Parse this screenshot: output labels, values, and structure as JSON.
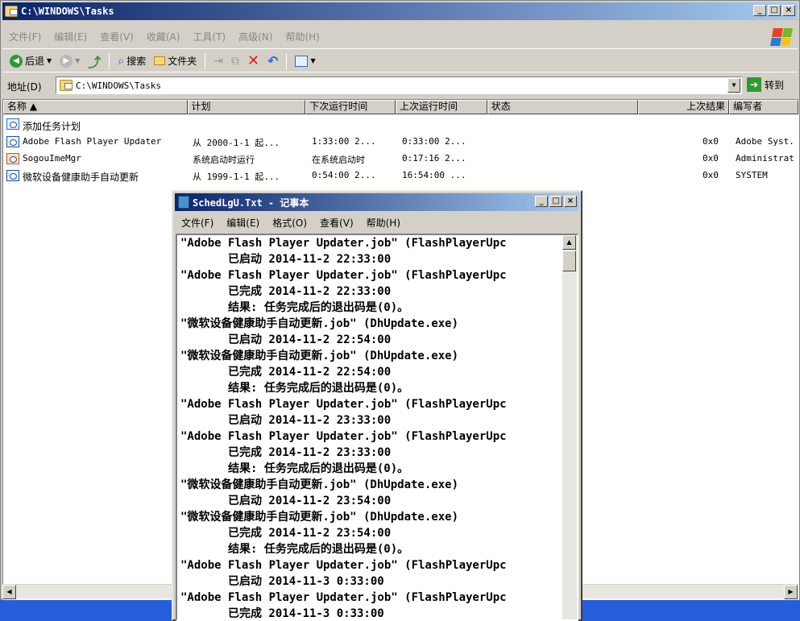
{
  "explorer": {
    "title": "C:\\WINDOWS\\Tasks",
    "menu": [
      "文件(F)",
      "编辑(E)",
      "查看(V)",
      "收藏(A)",
      "工具(T)",
      "高级(N)",
      "帮助(H)"
    ],
    "toolbar": {
      "back": "后退",
      "search": "搜索",
      "folders": "文件夹"
    },
    "address": {
      "label": "地址(D)",
      "value": "C:\\WINDOWS\\Tasks",
      "go": "转到"
    },
    "columns": [
      "名称 ▲",
      "计划",
      "下次运行时间",
      "上次运行时间",
      "状态",
      "上次结果",
      "编写者"
    ],
    "rows": [
      {
        "name": "添加任务计划",
        "schedule": "",
        "next": "",
        "last": "",
        "status": "",
        "result": "",
        "author": ""
      },
      {
        "name": "Adobe Flash Player Updater",
        "schedule": "从 2000-1-1 起...",
        "next": "1:33:00  2...",
        "last": "0:33:00  2...",
        "status": "",
        "result": "0x0",
        "author": "Adobe Syst."
      },
      {
        "name": "SogouImeMgr",
        "schedule": "系统启动时运行",
        "next": "在系统启动时",
        "last": "0:17:16  2...",
        "status": "",
        "result": "0x0",
        "author": "Administrat"
      },
      {
        "name": "微软设备健康助手自动更新",
        "schedule": "从 1999-1-1 起...",
        "next": "0:54:00  2...",
        "last": "16:54:00  ...",
        "status": "",
        "result": "0x0",
        "author": "SYSTEM"
      }
    ]
  },
  "notepad": {
    "title": "SchedLgU.Txt - 记事本",
    "menu": [
      "文件(F)",
      "编辑(E)",
      "格式(O)",
      "查看(V)",
      "帮助(H)"
    ],
    "lines": [
      "\"Adobe Flash Player Updater.job\" (FlashPlayerUpc",
      "       已启动 2014-11-2 22:33:00",
      "\"Adobe Flash Player Updater.job\" (FlashPlayerUpc",
      "       已完成 2014-11-2 22:33:00",
      "       结果: 任务完成后的退出码是(0)。",
      "\"微软设备健康助手自动更新.job\" (DhUpdate.exe)",
      "       已启动 2014-11-2 22:54:00",
      "\"微软设备健康助手自动更新.job\" (DhUpdate.exe)",
      "       已完成 2014-11-2 22:54:00",
      "       结果: 任务完成后的退出码是(0)。",
      "\"Adobe Flash Player Updater.job\" (FlashPlayerUpc",
      "       已启动 2014-11-2 23:33:00",
      "\"Adobe Flash Player Updater.job\" (FlashPlayerUpc",
      "       已完成 2014-11-2 23:33:00",
      "       结果: 任务完成后的退出码是(0)。",
      "\"微软设备健康助手自动更新.job\" (DhUpdate.exe)",
      "       已启动 2014-11-2 23:54:00",
      "\"微软设备健康助手自动更新.job\" (DhUpdate.exe)",
      "       已完成 2014-11-2 23:54:00",
      "       结果: 任务完成后的退出码是(0)。",
      "\"Adobe Flash Player Updater.job\" (FlashPlayerUpc",
      "       已启动 2014-11-3 0:33:00",
      "\"Adobe Flash Player Updater.job\" (FlashPlayerUpc",
      "       已完成 2014-11-3 0:33:00"
    ]
  },
  "colors": {
    "titlebar_start": "#0a246a",
    "titlebar_end": "#a6caf0",
    "chrome": "#d4d0c8",
    "taskbar": "#245edb"
  }
}
